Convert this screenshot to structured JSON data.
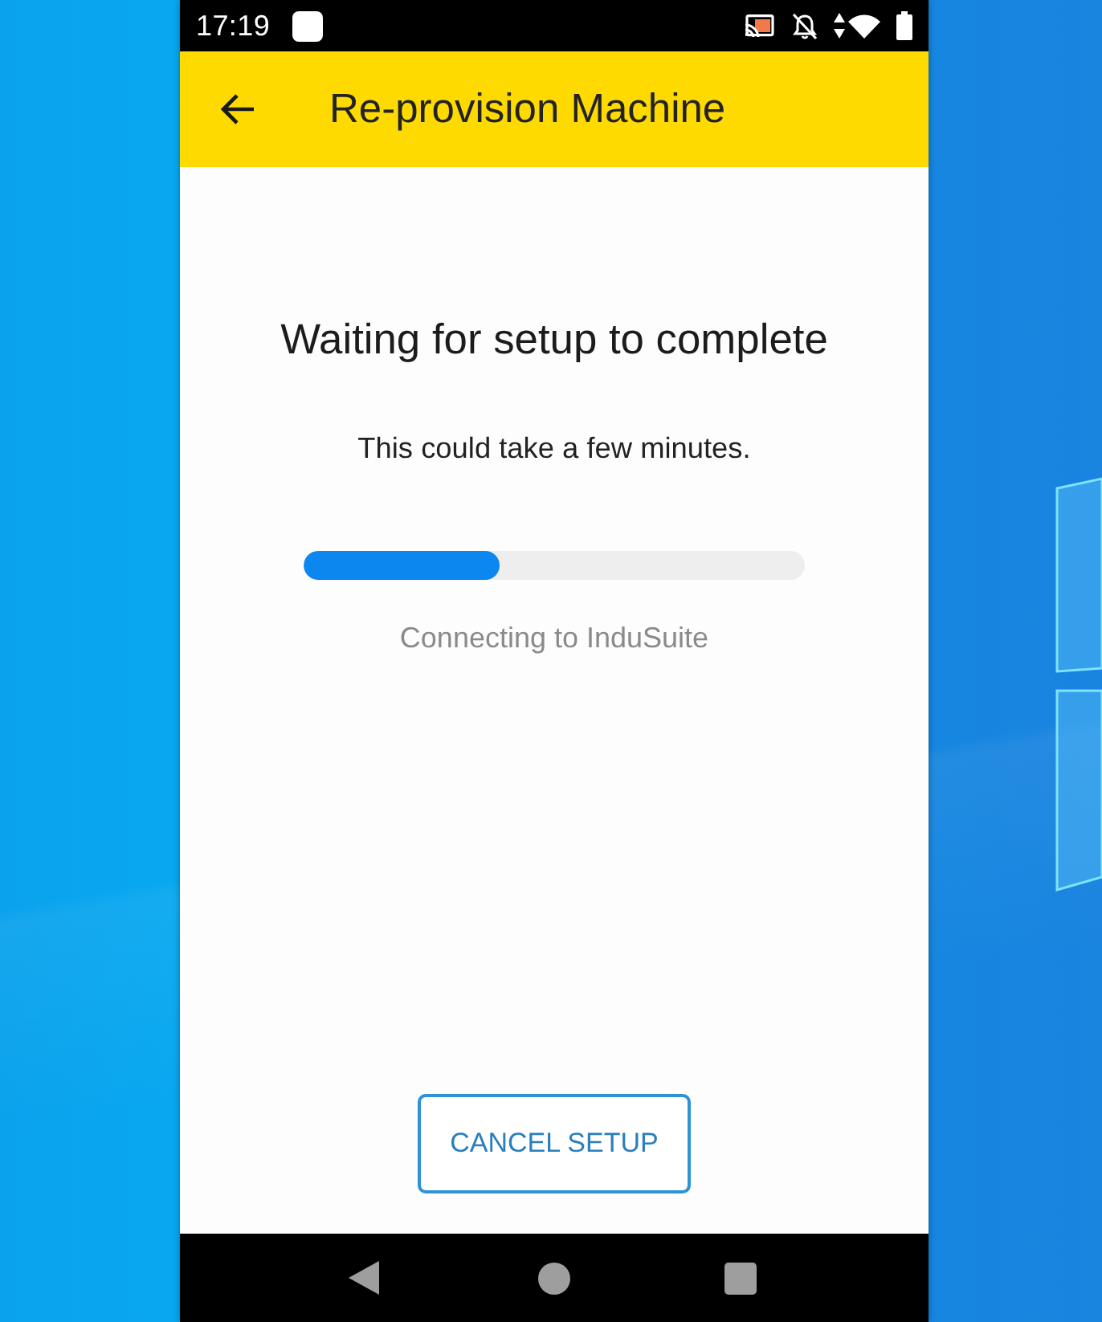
{
  "status_bar": {
    "time": "17:19"
  },
  "app_bar": {
    "title": "Re-provision Machine"
  },
  "content": {
    "heading": "Waiting for setup to complete",
    "subtitle": "This could take a few minutes.",
    "progress": {
      "level": 0.39
    },
    "status": "Connecting to InduSuite"
  },
  "cancel_button": {
    "label": "CANCEL SETUP"
  }
}
